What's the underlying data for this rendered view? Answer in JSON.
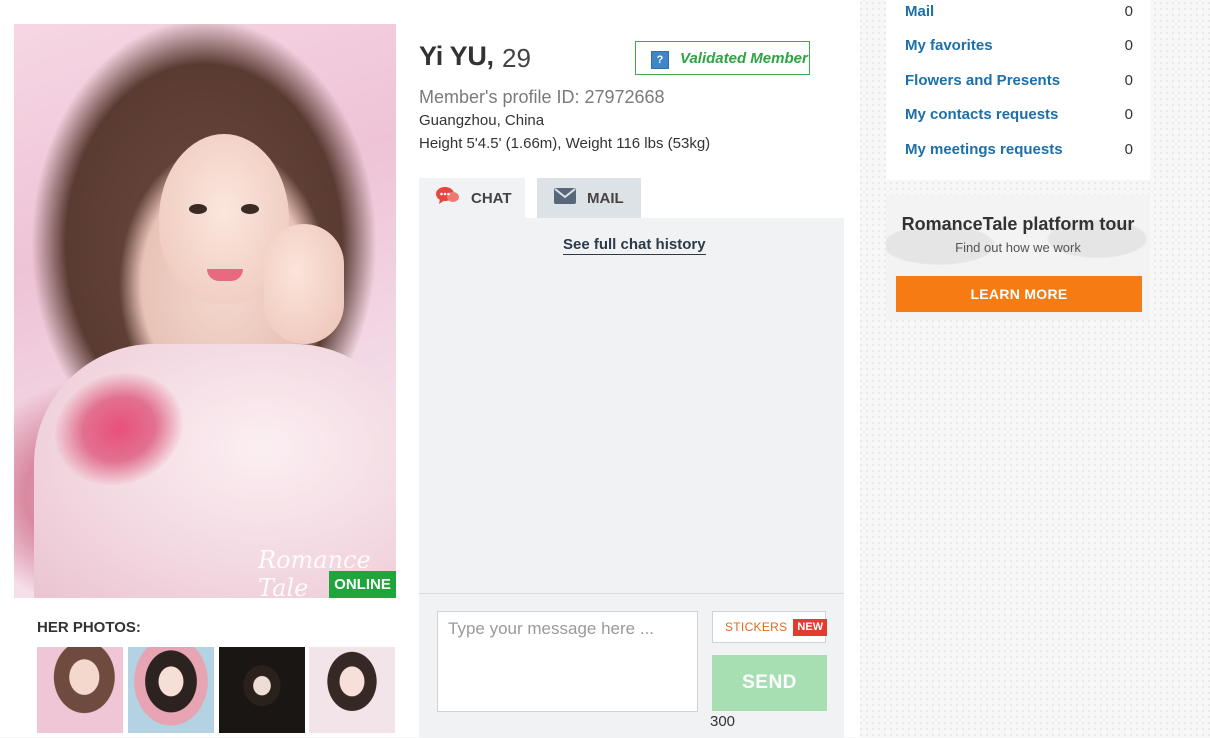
{
  "profile": {
    "name": "Yi YU,",
    "age": "29",
    "validated_label": "Validated Member",
    "validated_icon": "question-icon",
    "profile_id": "Member's profile ID: 27972668",
    "location": "Guangzhou, China",
    "body": "Height 5'4.5' (1.66m), Weight 116 lbs (53kg)",
    "status": "ONLINE",
    "photo_watermark": "Romance Tale"
  },
  "photos": {
    "title": "HER PHOTOS:",
    "count": 4
  },
  "tabs": [
    {
      "label": "CHAT",
      "icon": "chat-bubbles-icon",
      "active": true
    },
    {
      "label": "MAIL",
      "icon": "envelope-icon",
      "active": false
    }
  ],
  "chat": {
    "history_link": "See full chat history",
    "input_placeholder": "Type your message here ...",
    "char_counter": "300",
    "stickers_label": "STICKERS",
    "new_badge": "NEW",
    "send_label": "SEND"
  },
  "sidebar": {
    "menu": [
      {
        "label": "Mail",
        "count": "0"
      },
      {
        "label": "My favorites",
        "count": "0"
      },
      {
        "label": "Flowers and Presents",
        "count": "0"
      },
      {
        "label": "My contacts requests",
        "count": "0"
      },
      {
        "label": "My meetings requests",
        "count": "0"
      }
    ],
    "tour": {
      "title": "RomanceTale platform tour",
      "subtitle": "Find out how we work",
      "button": "LEARN MORE"
    }
  },
  "colors": {
    "online": "#1fa53b",
    "validated": "#2ea540",
    "link": "#1d6fa8",
    "accent_orange": "#f57b12",
    "send_disabled": "#a7dfb3"
  }
}
